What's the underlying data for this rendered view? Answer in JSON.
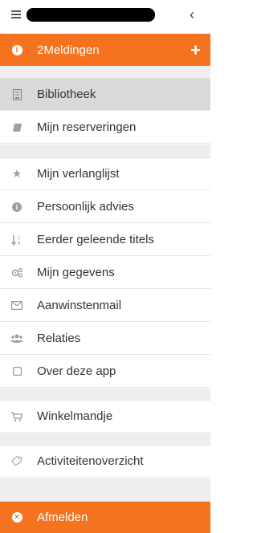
{
  "header": {
    "menu_icon": "hamburger-icon",
    "back_icon": "chevron-left-icon",
    "back_glyph": "‹"
  },
  "notifications": {
    "label": "2Meldingen",
    "icon": "info-icon",
    "add_glyph": "+"
  },
  "menu": {
    "library": {
      "label": "Bibliotheek"
    },
    "reservations": {
      "label": "Mijn reserveringen"
    },
    "wishlist": {
      "label": "Mijn verlanglijst"
    },
    "advice": {
      "label": "Persoonlijk advies"
    },
    "read_titles": {
      "label": "Eerder geleende titels"
    },
    "my_data": {
      "label": "Mijn gegevens"
    },
    "new_acquisitions_mail": {
      "label": "Aanwinstenmail"
    },
    "relations": {
      "label": "Relaties"
    },
    "about_app": {
      "label": "Over deze app"
    },
    "cart": {
      "label": "Winkelmandje"
    },
    "activity": {
      "label": "Activiteitenoverzicht"
    }
  },
  "logout": {
    "label": "Afmelden"
  },
  "colors": {
    "accent": "#f5731f",
    "active_bg": "#d9d9d9",
    "spacer": "#eeeeee"
  }
}
